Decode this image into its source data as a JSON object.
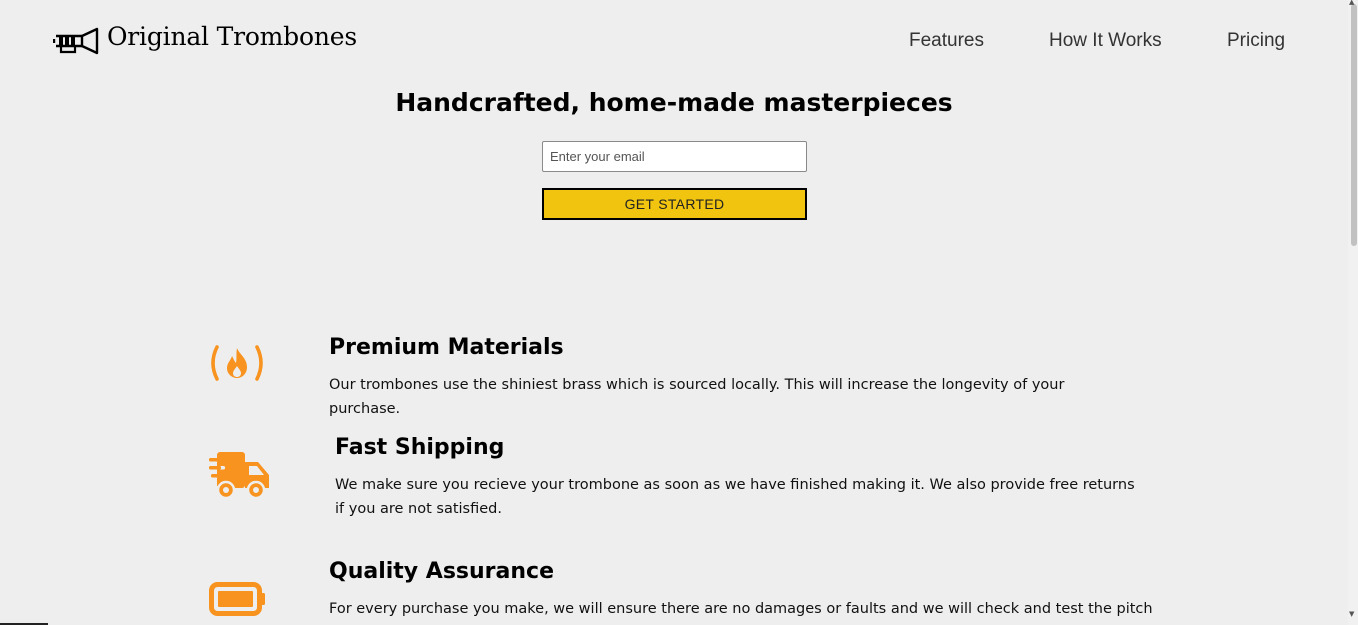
{
  "header": {
    "brand": "Original Trombones",
    "nav": [
      {
        "label": "Features"
      },
      {
        "label": "How It Works"
      },
      {
        "label": "Pricing"
      }
    ]
  },
  "hero": {
    "title": "Handcrafted, home-made masterpieces",
    "email_placeholder": "Enter your email",
    "button_label": "GET STARTED"
  },
  "features": [
    {
      "icon": "fire-icon",
      "title": "Premium Materials",
      "description": "Our trombones use the shiniest brass which is sourced locally. This will increase the longevity of your purchase."
    },
    {
      "icon": "truck-icon",
      "title": "Fast Shipping",
      "description": "We make sure you recieve your trombone as soon as we have finished making it. We also provide free returns if you are not satisfied."
    },
    {
      "icon": "battery-icon",
      "title": "Quality Assurance",
      "description": "For every purchase you make, we will ensure there are no damages or faults and we will check and test the pitch"
    }
  ],
  "colors": {
    "background": "#eeeeee",
    "accent_icon": "#f7931e",
    "button": "#f1c40f"
  }
}
